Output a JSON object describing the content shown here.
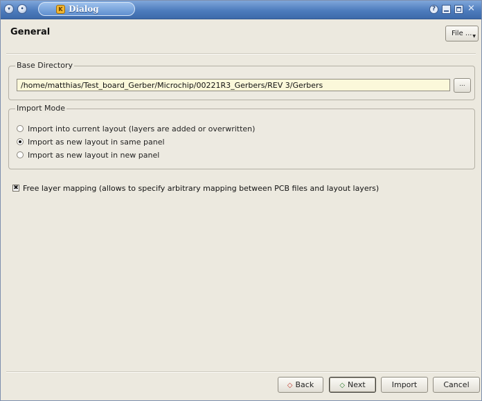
{
  "window": {
    "title": "Dialog",
    "app_icon_letter": "K",
    "help_glyph": "?",
    "close_glyph": "✕"
  },
  "header": {
    "title": "General",
    "file_button": "File ..."
  },
  "base_directory": {
    "group_label": "Base Directory",
    "path_value": "/home/matthias/Test_board_Gerber/Microchip/00221R3_Gerbers/REV 3/Gerbers",
    "browse_label": "..."
  },
  "import_mode": {
    "group_label": "Import Mode",
    "options": [
      {
        "label": "Import into current layout (layers are added or overwritten)",
        "selected": false
      },
      {
        "label": "Import as new layout in same panel",
        "selected": true
      },
      {
        "label": "Import as new layout in new panel",
        "selected": false
      }
    ]
  },
  "free_layer_mapping": {
    "checked": true,
    "check_glyph": "✖",
    "label": "Free layer mapping (allows to specify arbitrary mapping between PCB files and layout layers)"
  },
  "footer": {
    "back_label": "Back",
    "next_label": "Next",
    "import_label": "Import",
    "cancel_label": "Cancel",
    "back_icon": "◇",
    "next_icon": "◇"
  },
  "icons": [
    "window-menu-icon",
    "sticky-icon",
    "help-icon",
    "minimize-icon",
    "maximize-icon",
    "close-icon",
    "back-arrow-icon",
    "next-arrow-icon",
    "dropdown-arrow-icon"
  ],
  "colors": {
    "titlebar": "#4d7cbd",
    "background": "#ece9df",
    "input_background": "#fbf8da"
  }
}
